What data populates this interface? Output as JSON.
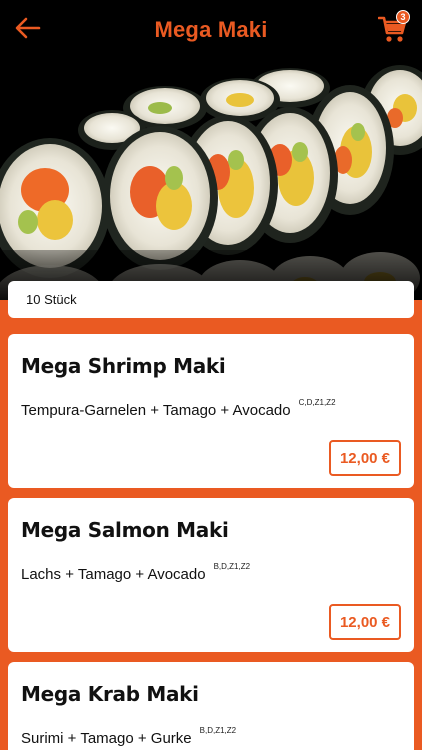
{
  "header": {
    "title": "Mega Maki",
    "back_icon": "arrow-left-icon",
    "cart_icon": "cart-icon",
    "cart_count": "3",
    "accent_color": "#ea5a22",
    "background_color": "#000000"
  },
  "hero": {
    "image": "sushi-maki-rolls"
  },
  "pieces_label": "10 Stück",
  "items": [
    {
      "name": "Mega Shrimp Maki",
      "description": "Tempura-Garnelen + Tamago + Avocado",
      "allergens": "C,D,Z1,Z2",
      "price": "12,00 €"
    },
    {
      "name": "Mega Salmon Maki",
      "description": "Lachs + Tamago + Avocado",
      "allergens": "B,D,Z1,Z2",
      "price": "12,00 €"
    },
    {
      "name": "Mega Krab Maki",
      "description": "Surimi + Tamago + Gurke",
      "allergens": "B,D,Z1,Z2"
    }
  ]
}
